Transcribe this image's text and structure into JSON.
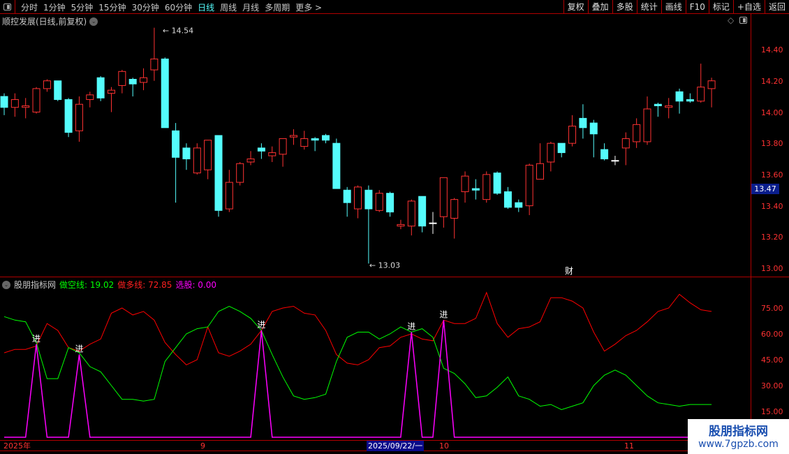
{
  "toolbar": {
    "periods": [
      "分时",
      "1分钟",
      "5分钟",
      "15分钟",
      "30分钟",
      "60分钟",
      "日线",
      "周线",
      "月线",
      "多周期",
      "更多 >"
    ],
    "active": "日线",
    "right_buttons": [
      "复权",
      "叠加",
      "多股",
      "统计",
      "画线",
      "F10",
      "标记",
      "+自选",
      "返回"
    ]
  },
  "chart": {
    "title": "顺控发展(日线,前复权)",
    "high_label": "14.54",
    "low_label": "13.03",
    "current_price": "13.47",
    "event_marker": "财",
    "y_labels": [
      "14.40",
      "14.20",
      "14.00",
      "13.80",
      "13.60",
      "13.40",
      "13.20",
      "13.00"
    ],
    "colors": {
      "up": "#ff3232",
      "down": "#54fcfc"
    },
    "candles": [
      [
        14.1,
        14.03,
        14.12,
        13.98
      ],
      [
        14.03,
        14.08,
        14.12,
        13.97
      ],
      [
        14.03,
        14.04,
        14.09,
        13.96
      ],
      [
        14.0,
        14.15,
        14.16,
        13.99
      ],
      [
        14.15,
        14.2,
        14.21,
        14.13
      ],
      [
        14.2,
        14.08,
        14.2,
        14.07
      ],
      [
        14.08,
        13.87,
        14.09,
        13.84
      ],
      [
        13.88,
        14.05,
        14.1,
        13.81
      ],
      [
        14.08,
        14.11,
        14.13,
        14.03
      ],
      [
        14.22,
        14.09,
        14.23,
        14.07
      ],
      [
        14.12,
        14.14,
        14.16,
        14.0
      ],
      [
        14.17,
        14.26,
        14.27,
        14.12
      ],
      [
        14.21,
        14.18,
        14.22,
        14.1
      ],
      [
        14.19,
        14.22,
        14.28,
        14.14
      ],
      [
        14.27,
        14.34,
        14.54,
        14.2
      ],
      [
        14.34,
        13.9,
        14.35,
        13.9
      ],
      [
        13.88,
        13.71,
        13.93,
        13.42
      ],
      [
        13.77,
        13.7,
        13.8,
        13.63
      ],
      [
        13.61,
        13.77,
        13.8,
        13.6
      ],
      [
        13.63,
        13.82,
        13.82,
        13.57
      ],
      [
        13.85,
        13.37,
        13.85,
        13.33
      ],
      [
        13.38,
        13.55,
        13.63,
        13.36
      ],
      [
        13.55,
        13.67,
        13.68,
        13.53
      ],
      [
        13.68,
        13.7,
        13.75,
        13.66
      ],
      [
        13.77,
        13.75,
        13.8,
        13.7
      ],
      [
        13.72,
        13.74,
        13.78,
        13.68
      ],
      [
        13.73,
        13.83,
        13.83,
        13.65
      ],
      [
        13.84,
        13.85,
        13.89,
        13.79
      ],
      [
        13.78,
        13.83,
        13.88,
        13.76
      ],
      [
        13.83,
        13.82,
        13.84,
        13.75
      ],
      [
        13.85,
        13.82,
        13.86,
        13.8
      ],
      [
        13.8,
        13.51,
        13.83,
        13.51
      ],
      [
        13.5,
        13.42,
        13.52,
        13.33
      ],
      [
        13.38,
        13.52,
        13.53,
        13.32
      ],
      [
        13.5,
        13.38,
        13.53,
        13.03
      ],
      [
        13.37,
        13.48,
        13.5,
        13.36
      ],
      [
        13.48,
        13.36,
        13.49,
        13.33
      ],
      [
        13.27,
        13.28,
        13.31,
        13.25
      ],
      [
        13.27,
        13.43,
        13.44,
        13.21
      ],
      [
        13.46,
        13.27,
        13.46,
        13.23
      ],
      [
        13.29,
        13.29,
        13.36,
        13.22
      ],
      [
        13.33,
        13.58,
        13.58,
        13.26
      ],
      [
        13.32,
        13.44,
        13.45,
        13.19
      ],
      [
        13.49,
        13.59,
        13.62,
        13.42
      ],
      [
        13.51,
        13.5,
        13.57,
        13.44
      ],
      [
        13.44,
        13.6,
        13.62,
        13.42
      ],
      [
        13.61,
        13.48,
        13.62,
        13.47
      ],
      [
        13.49,
        13.39,
        13.52,
        13.38
      ],
      [
        13.42,
        13.39,
        13.44,
        13.36
      ],
      [
        13.4,
        13.66,
        13.67,
        13.34
      ],
      [
        13.57,
        13.67,
        13.8,
        13.57
      ],
      [
        13.68,
        13.8,
        13.81,
        13.62
      ],
      [
        13.8,
        13.74,
        13.8,
        13.71
      ],
      [
        13.8,
        13.91,
        13.98,
        13.78
      ],
      [
        13.96,
        13.9,
        14.05,
        13.83
      ],
      [
        13.93,
        13.86,
        13.95,
        13.71
      ],
      [
        13.76,
        13.7,
        13.8,
        13.69
      ],
      [
        13.69,
        13.69,
        13.72,
        13.66
      ],
      [
        13.77,
        13.83,
        13.87,
        13.66
      ],
      [
        13.81,
        13.92,
        13.96,
        13.77
      ],
      [
        13.81,
        14.02,
        14.1,
        13.79
      ],
      [
        14.05,
        14.04,
        14.06,
        13.97
      ],
      [
        14.03,
        14.04,
        14.09,
        13.96
      ],
      [
        14.13,
        14.07,
        14.15,
        13.99
      ],
      [
        14.08,
        14.07,
        14.12,
        14.06
      ],
      [
        14.07,
        14.16,
        14.31,
        14.06
      ],
      [
        14.15,
        14.2,
        14.22,
        14.03
      ]
    ]
  },
  "indicator": {
    "name": "股朋指标网",
    "short_label": "做空线: 19.02",
    "long_label": "做多线: 72.85",
    "select_label": "选股: 0.00",
    "colors": {
      "short": "#00ff00",
      "long": "#ff0000",
      "select": "#ff00ff"
    },
    "y_labels": [
      "75.00",
      "60.00",
      "45.00",
      "30.00",
      "15.00"
    ],
    "signal_label": "进",
    "short": [
      70,
      68,
      67,
      55,
      34,
      34,
      52,
      49,
      41,
      38,
      30,
      22,
      22,
      21,
      22,
      44,
      52,
      60,
      63,
      64,
      73,
      76,
      73,
      69,
      62,
      48,
      35,
      24,
      22,
      23,
      25,
      44,
      58,
      61,
      61,
      57,
      60,
      64,
      61,
      63,
      58,
      40,
      37,
      31,
      23,
      24,
      29,
      35,
      24,
      22,
      18,
      19,
      16,
      18,
      20,
      30,
      36,
      39,
      36,
      30,
      24,
      20,
      19,
      18,
      19,
      19,
      19
    ],
    "long": [
      49,
      51,
      51,
      53,
      66,
      62,
      52,
      50,
      54,
      57,
      72,
      75,
      71,
      73,
      68,
      55,
      48,
      42,
      45,
      64,
      49,
      47,
      50,
      54,
      62,
      73,
      75,
      76,
      72,
      71,
      62,
      48,
      43,
      42,
      45,
      52,
      53,
      58,
      60,
      57,
      56,
      68,
      66,
      66,
      69,
      84,
      66,
      58,
      63,
      64,
      67,
      81,
      81,
      79,
      75,
      61,
      50,
      54,
      59,
      62,
      67,
      73,
      75,
      83,
      78,
      74,
      73
    ],
    "signals": [
      {
        "index": 3,
        "value": 54
      },
      {
        "index": 7,
        "value": 48
      },
      {
        "index": 24,
        "value": 62
      },
      {
        "index": 38,
        "value": 61
      },
      {
        "index": 41,
        "value": 68
      }
    ]
  },
  "xaxis": {
    "labels": [
      "2025年",
      "9",
      "10",
      "11"
    ],
    "cursor_date": "2025/09/22/一"
  },
  "watermark": {
    "name": "股朋指标网",
    "url": "www.7gpzb.com"
  }
}
